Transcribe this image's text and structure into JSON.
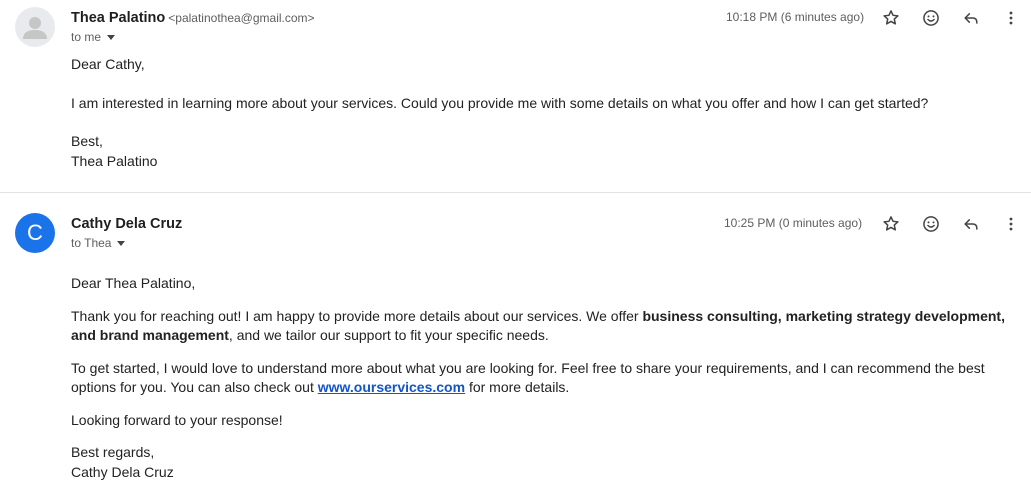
{
  "message1": {
    "sender_name": "Thea Palatino",
    "sender_email": "<palatinothea@gmail.com>",
    "recipient": "to me",
    "time": "10:18 PM (6 minutes ago)",
    "greeting": "Dear Cathy,",
    "paragraph1": "I am interested in learning more about your services. Could you provide me with some details on what you offer and how I can get started?",
    "signoff": "Best,",
    "signature": "Thea Palatino"
  },
  "message2": {
    "avatar_letter": "C",
    "sender_name": "Cathy Dela Cruz",
    "recipient": "to Thea",
    "time": "10:25 PM (0 minutes ago)",
    "greeting": "Dear Thea Palatino,",
    "p1_a": "Thank you for reaching out! I am happy to provide more details about our services. We offer ",
    "p1_bold": "business consulting, marketing strategy development, and brand management",
    "p1_b": ", and we tailor our support to fit your specific needs.",
    "p2_a": "To get started, I would love to understand more about what you are looking for. Feel free to share your requirements, and I can recommend the best options for you. You can also check out ",
    "p2_link": "www.ourservices.com",
    "p2_b": " for more details.",
    "p3": "Looking forward to your response!",
    "signoff": "Best regards,",
    "signature": "Cathy Dela Cruz"
  },
  "icons": [
    "star-icon",
    "emoji-icon",
    "reply-icon",
    "more-vert-icon"
  ],
  "colors": {
    "avatar_blue": "#1a73e8",
    "link": "#1155cc"
  }
}
